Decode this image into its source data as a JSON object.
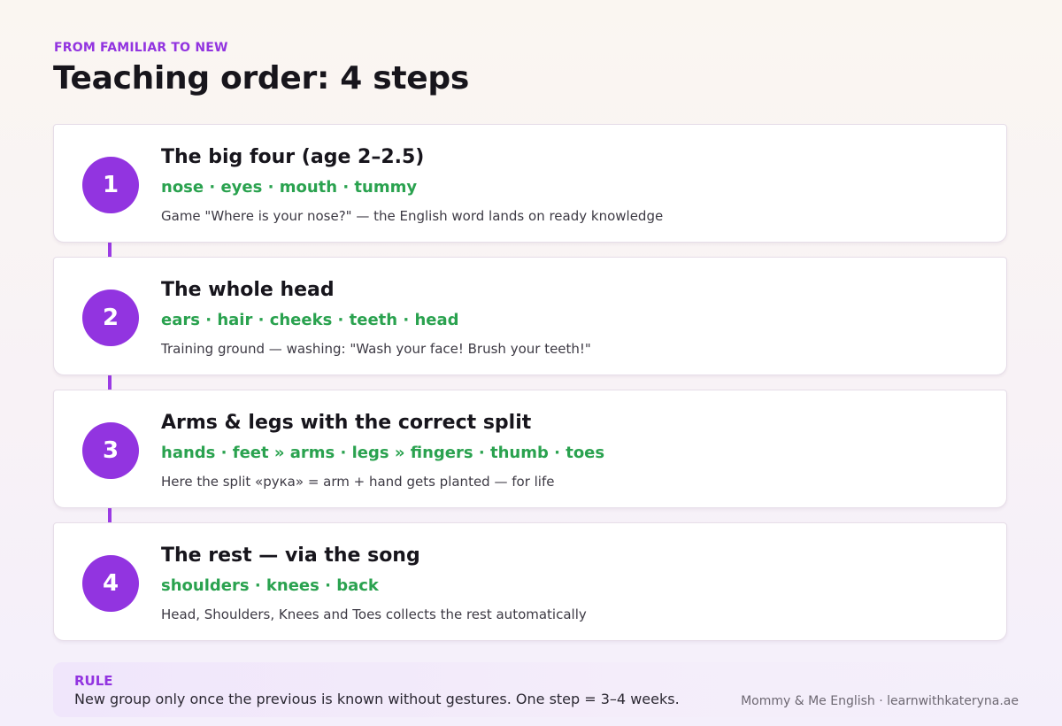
{
  "header": {
    "eyebrow": "FROM FAMILIAR TO NEW",
    "title": "Teaching order: 4 steps"
  },
  "steps": [
    {
      "number": "1",
      "title": "The big four (age 2–2.5)",
      "words": "nose · eyes · mouth · tummy",
      "note": "Game \"Where is your nose?\" — the English word lands on ready knowledge"
    },
    {
      "number": "2",
      "title": "The whole head",
      "words": "ears · hair · cheeks · teeth · head",
      "note": "Training ground — washing: \"Wash your face! Brush your teeth!\""
    },
    {
      "number": "3",
      "title": "Arms & legs with the correct split",
      "words": "hands · feet » arms · legs » fingers · thumb · toes",
      "note": "Here the split «рука» = arm + hand gets planted — for life"
    },
    {
      "number": "4",
      "title": "The rest — via the song",
      "words": "shoulders · knees · back",
      "note": "Head, Shoulders, Knees and Toes collects the rest automatically"
    }
  ],
  "rule": {
    "label": "RULE",
    "text": "New group only once the previous is known without gestures. One step = 3–4 weeks."
  },
  "footer": {
    "credit": "Mommy & Me English · learnwithkateryna.ae"
  },
  "colors": {
    "accent": "#9234e0",
    "words": "#2aa24f"
  }
}
